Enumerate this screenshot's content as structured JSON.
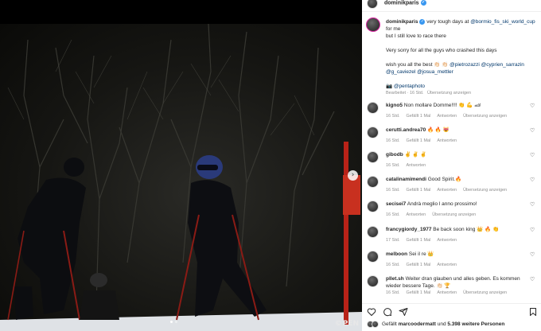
{
  "post": {
    "username": "dominikparis",
    "verified_badge": "✓",
    "caption": {
      "username": "dominikparis",
      "line1_text": " very tough days at ",
      "line1_mention": "@bormio_fis_ski_world_cup",
      "line2": "for me",
      "line3": "but I still love to race there",
      "line4": "Very sorry for all the guys who crashed this days",
      "line5_text": "wish you all the best 👏🏻 👏🏻 ",
      "line5_mention1": "@pietrozazzi",
      "line5_mention2": "@cyprien_sarrazin",
      "line6_mention1": "@g_caviezel",
      "line6_mention2": "@josua_mettler",
      "photo_credit_icon": "📷",
      "photo_credit": "@pentaphoto",
      "edited": "Bearbeitet · 16 Std.",
      "translate": "Übersetzung anzeigen"
    },
    "photo": {
      "watermark": "PEN",
      "watermark_copy": "©"
    }
  },
  "comments": [
    {
      "user": "kigno5",
      "text": "Non mollare Domme!!!! 👏 💪 🏎",
      "time": "16 Std.",
      "likes": "Gefällt 1 Mal",
      "reply": "Antworten",
      "translate": "Übersetzung anzeigen"
    },
    {
      "user": "cerutti.andrea70",
      "text": "🔥 🔥 😻",
      "time": "16 Std.",
      "likes": "Gefällt 1 Mal",
      "reply": "Antworten",
      "translate": ""
    },
    {
      "user": "gibodb",
      "text": "✌ ✌ ✌",
      "time": "16 Std.",
      "likes": "",
      "reply": "Antworten",
      "translate": ""
    },
    {
      "user": "catalinamimendi",
      "text": "Good Spirit.🔥",
      "time": "16 Std.",
      "likes": "Gefällt 1 Mal",
      "reply": "Antworten",
      "translate": "Übersetzung anzeigen"
    },
    {
      "user": "secisei7",
      "text": "Andrà meglio l anno prossimo!",
      "time": "16 Std.",
      "likes": "",
      "reply": "Antworten",
      "translate": "Übersetzung anzeigen"
    },
    {
      "user": "francygiordy_1977",
      "text": "Be back soon king 👑 🔥 👏",
      "time": "17 Std.",
      "likes": "Gefällt 1 Mal",
      "reply": "Antworten",
      "translate": ""
    },
    {
      "user": "melboon",
      "text": "Sei il re 👑",
      "time": "16 Std.",
      "likes": "Gefällt 1 Mal",
      "reply": "Antworten",
      "translate": ""
    },
    {
      "user": "pllet.sh",
      "text": "Weiter dran glauben und alles geben. Es kommen",
      "text2": "wieder bessere Tage. 👏🏻 🏆",
      "time": "16 Std.",
      "likes": "Gefällt 1 Mal",
      "reply": "Antworten",
      "translate": "Übersetzung anzeigen"
    }
  ],
  "footer": {
    "likes_prefix": "Gefällt ",
    "likes_user": "marcoodermatt",
    "likes_middle": " und ",
    "likes_count": "5.398 weitere Personen"
  },
  "icons": [
    "heart-icon",
    "comment-icon",
    "share-icon",
    "bookmark-icon",
    "chevron-right-icon",
    "verified-icon"
  ],
  "colors": {
    "link": "#00376b",
    "muted": "#8e8e8e",
    "verified": "#3897f0"
  }
}
